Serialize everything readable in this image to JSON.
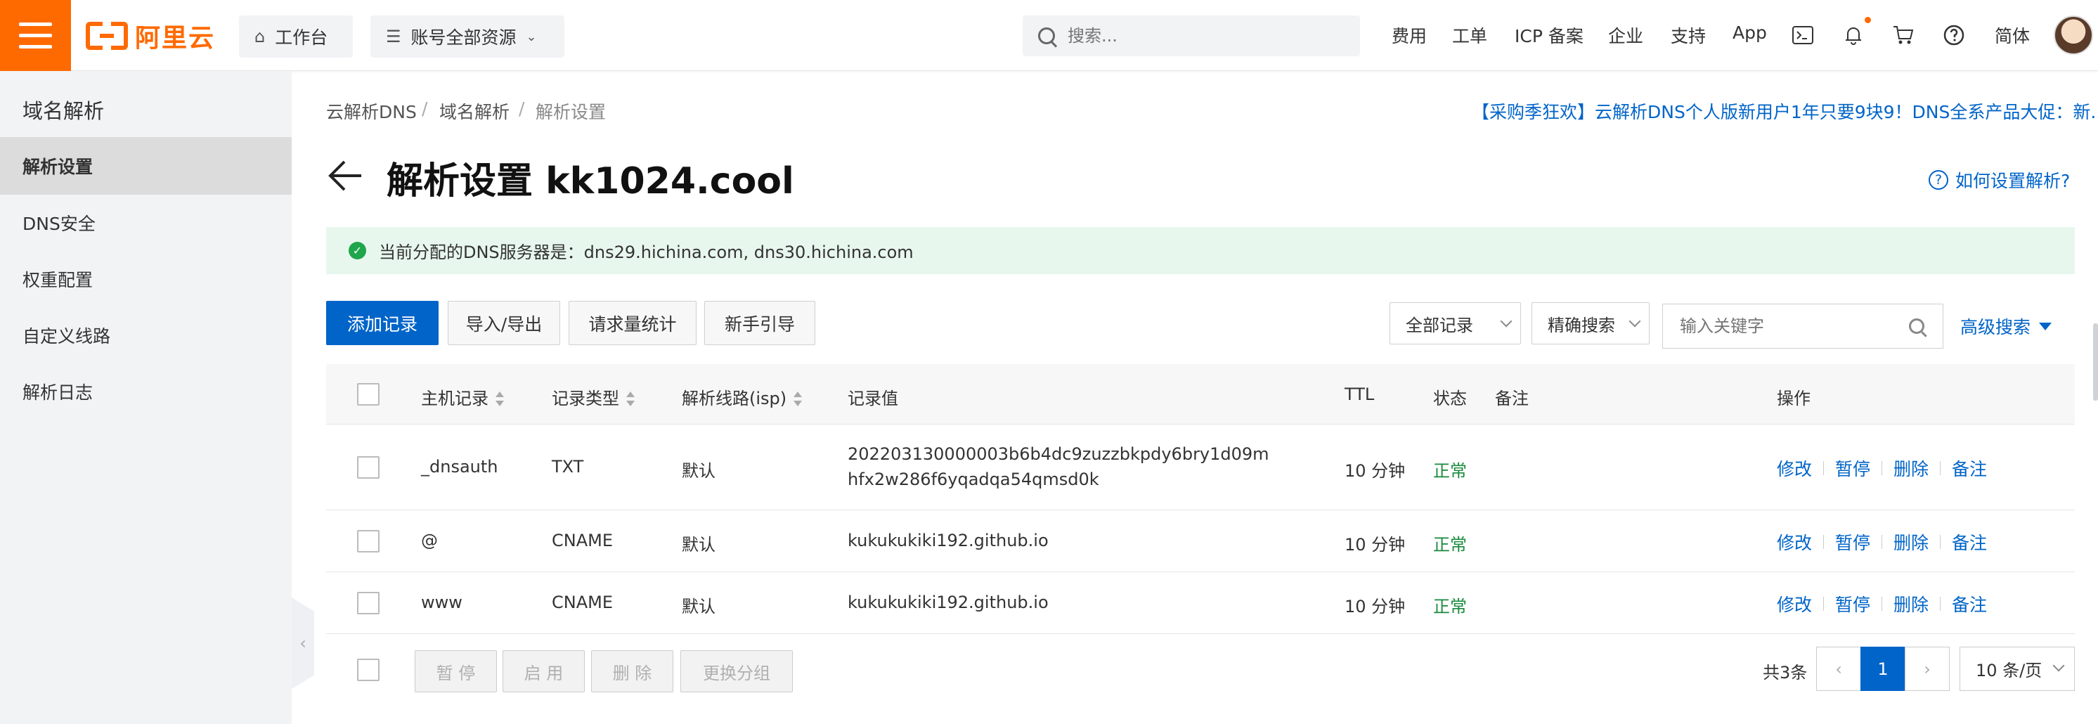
{
  "topbar": {
    "logo_text": "阿里云",
    "workbench": "工作台",
    "resources": "账号全部资源",
    "search_placeholder": "搜索...",
    "links": [
      "费用",
      "工单",
      "ICP 备案",
      "企业",
      "支持",
      "App"
    ],
    "lang": "简体"
  },
  "sidebar": {
    "title": "域名解析",
    "items": [
      {
        "label": "解析设置",
        "active": true
      },
      {
        "label": "DNS安全"
      },
      {
        "label": "权重配置"
      },
      {
        "label": "自定义线路"
      },
      {
        "label": "解析日志"
      }
    ]
  },
  "breadcrumb": [
    "云解析DNS",
    "域名解析",
    "解析设置"
  ],
  "promo": "【采购季狂欢】云解析DNS个人版新用户1年只要9块9！DNS全系产品大促：新...",
  "page_title": "解析设置 kk1024.cool",
  "help_link": "如何设置解析?",
  "alert": "当前分配的DNS服务器是：dns29.hichina.com, dns30.hichina.com",
  "toolbar": {
    "add": "添加记录",
    "import_export": "导入/导出",
    "stats": "请求量统计",
    "guide": "新手引导",
    "filter_all": "全部记录",
    "filter_mode": "精确搜索",
    "keyword_placeholder": "输入关键字",
    "advanced": "高级搜索"
  },
  "table": {
    "headers": [
      "主机记录",
      "记录类型",
      "解析线路(isp)",
      "记录值",
      "TTL",
      "状态",
      "备注",
      "操作"
    ],
    "rows": [
      {
        "host": "_dnsauth",
        "type": "TXT",
        "line": "默认",
        "value": "202203130000003b6b4dc9zuzzbkpdy6bry1d09mhfx2w286f6yqadqa54qmsd0k",
        "ttl": "10 分钟",
        "status": "正常",
        "remark": ""
      },
      {
        "host": "@",
        "type": "CNAME",
        "line": "默认",
        "value": "kukukukiki192.github.io",
        "ttl": "10 分钟",
        "status": "正常",
        "remark": ""
      },
      {
        "host": "www",
        "type": "CNAME",
        "line": "默认",
        "value": "kukukukiki192.github.io",
        "ttl": "10 分钟",
        "status": "正常",
        "remark": ""
      }
    ],
    "ops": [
      "修改",
      "暂停",
      "删除",
      "备注"
    ]
  },
  "footer": {
    "pause": "暂 停",
    "enable": "启 用",
    "delete": "删 除",
    "change_group": "更换分组",
    "total": "共3条",
    "current_page": "1",
    "page_size": "10 条/页"
  },
  "colors": {
    "brand": "#ff6a00",
    "primary": "#0064c8",
    "success": "#1a8a3c"
  }
}
